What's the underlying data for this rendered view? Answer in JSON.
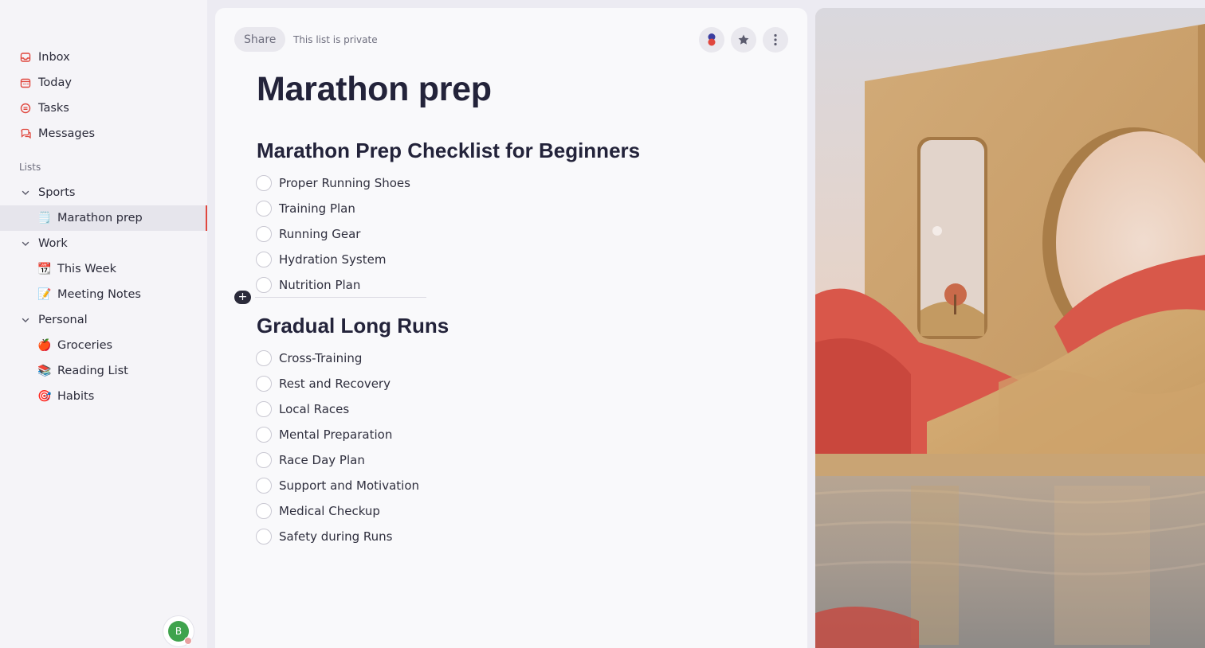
{
  "sidebar": {
    "nav": [
      {
        "label": "Inbox",
        "icon": "inbox-icon"
      },
      {
        "label": "Today",
        "icon": "calendar-icon"
      },
      {
        "label": "Tasks",
        "icon": "tasks-icon"
      },
      {
        "label": "Messages",
        "icon": "messages-icon"
      }
    ],
    "lists_label": "Lists",
    "groups": {
      "sports": {
        "label": "Sports",
        "items": [
          {
            "emoji": "🗒️",
            "label": "Marathon prep"
          }
        ]
      },
      "work": {
        "label": "Work",
        "items": [
          {
            "emoji": "📆",
            "label": "This Week"
          },
          {
            "emoji": "📝",
            "label": "Meeting Notes"
          }
        ]
      },
      "personal": {
        "label": "Personal",
        "items": [
          {
            "emoji": "🍎",
            "label": "Groceries"
          },
          {
            "emoji": "📚",
            "label": "Reading List"
          },
          {
            "emoji": "🎯",
            "label": "Habits"
          }
        ]
      }
    },
    "user_initial": "B"
  },
  "header": {
    "share_label": "Share",
    "privacy_text": "This list is private"
  },
  "page": {
    "title": "Marathon prep",
    "sections": [
      {
        "heading": "Marathon Prep Checklist for Beginners",
        "tasks": [
          "Proper Running Shoes",
          "Training Plan",
          "Running Gear",
          "Hydration System",
          "Nutrition Plan"
        ]
      },
      {
        "heading": "Gradual Long Runs",
        "tasks": [
          "Cross-Training",
          "Rest and Recovery",
          "Local Races",
          "Mental Preparation",
          "Race Day Plan",
          "Support and Motivation",
          "Medical Checkup",
          "Safety during Runs"
        ]
      }
    ]
  },
  "colors": {
    "accent": "#e0473e",
    "avatar": "#3fa34d",
    "sky": "#dcd8dc",
    "wall": "#c9a06a",
    "grass": "#d9574a",
    "water": "#9a9088"
  }
}
